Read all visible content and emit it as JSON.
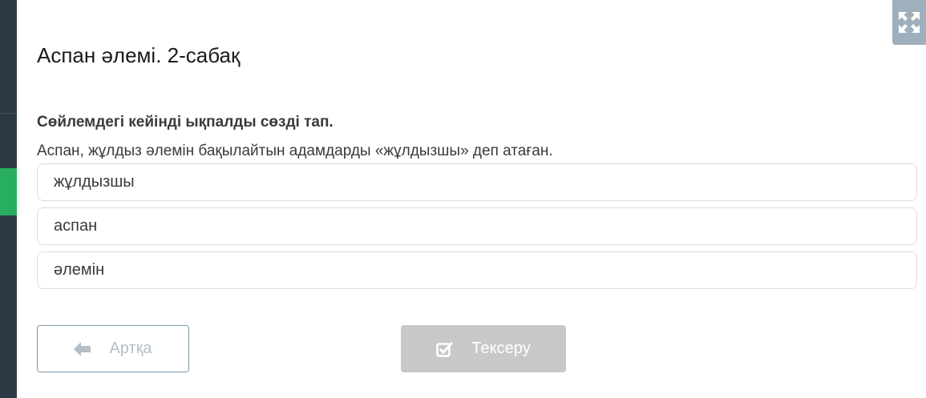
{
  "lesson": {
    "title": "Аспан әлемі. 2-сабақ"
  },
  "task": {
    "instruction": "Сөйлемдегі кейінді ықпалды сөзді тап.",
    "sentence": "Аспан, жұлдыз әлемін бақылайтын адамдарды «жұлдызшы» деп атаған."
  },
  "options": [
    {
      "label": "жұлдызшы"
    },
    {
      "label": "аспан"
    },
    {
      "label": "әлемін"
    }
  ],
  "buttons": {
    "back_label": "Артқа",
    "check_label": "Тексеру",
    "back_icon": "arrow-left-icon",
    "check_icon": "checkbox-check-icon",
    "expand_icon": "expand-arrows-icon"
  },
  "colors": {
    "sidebar": "#2b3a44",
    "sidebar_active": "#27ae60",
    "expand_button": "#9fb0bc",
    "check_button_disabled": "#c8c8c8",
    "back_button_border": "#7d98aa"
  }
}
